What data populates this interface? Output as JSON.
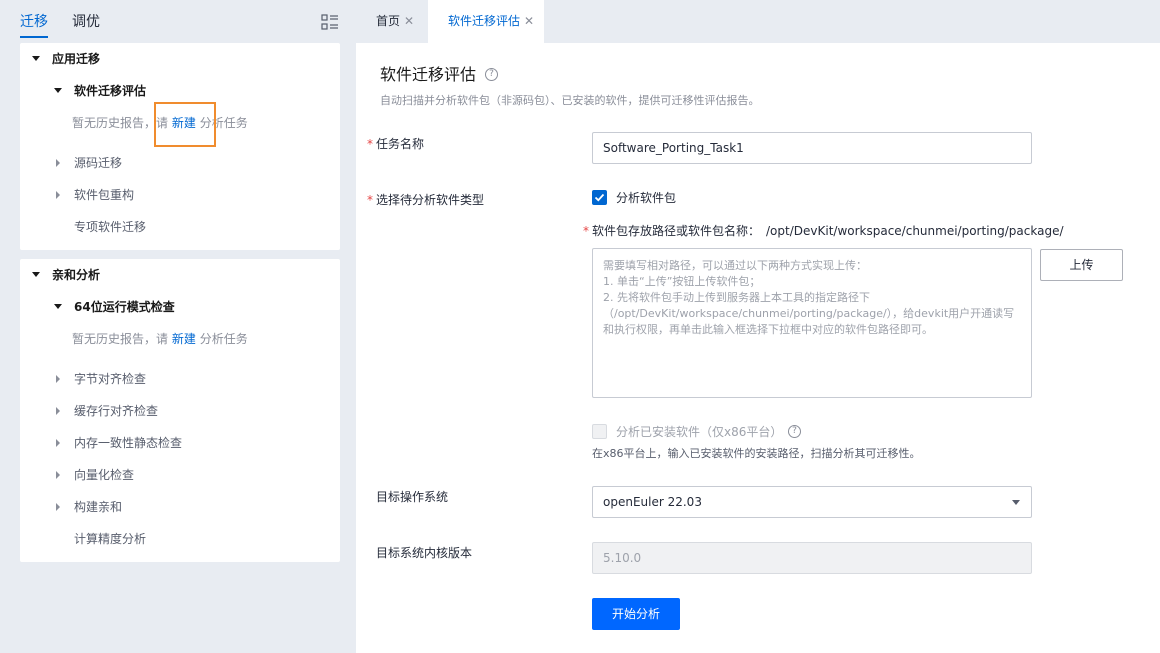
{
  "left_tabs": [
    {
      "label": "迁移",
      "active": true
    },
    {
      "label": "调优",
      "active": false
    }
  ],
  "tree": {
    "app_porting": {
      "label": "应用迁移",
      "software_eval": {
        "label": "软件迁移评估",
        "empty_prefix": "暂无历史报告，请",
        "empty_link": "新建",
        "empty_suffix": "分析任务"
      },
      "items": [
        "源码迁移",
        "软件包重构",
        "专项软件迁移"
      ]
    },
    "affinity": {
      "label": "亲和分析",
      "mode_check": {
        "label": "64位运行模式检查",
        "empty_prefix": "暂无历史报告，请",
        "empty_link": "新建",
        "empty_suffix": "分析任务"
      },
      "items": [
        "字节对齐检查",
        "缓存行对齐检查",
        "内存一致性静态检查",
        "向量化检查",
        "构建亲和",
        "计算精度分析"
      ]
    }
  },
  "top_tabs": [
    {
      "label": "首页",
      "active": false
    },
    {
      "label": "软件迁移评估",
      "active": true
    }
  ],
  "page": {
    "title": "软件迁移评估",
    "description": "自动扫描并分析软件包（非源码包）、已安装的软件，提供可迁移性评估报告。"
  },
  "form": {
    "task_name_label": "任务名称",
    "task_name_value": "Software_Porting_Task1",
    "type_label": "选择待分析软件类型",
    "analyze_package_label": "分析软件包",
    "analyze_package_checked": true,
    "path_label": "软件包存放路径或软件包名称：",
    "path_value": "/opt/DevKit/workspace/chunmei/porting/package/",
    "textarea_placeholder": [
      "需要填写相对路径，可以通过以下两种方式实现上传：",
      "1. 单击“上传”按钮上传软件包；",
      "2. 先将软件包手动上传到服务器上本工具的指定路径下",
      "（/opt/DevKit/workspace/chunmei/porting/package/），给devkit用户开通读写",
      "和执行权限，再单击此输入框选择下拉框中对应的软件包路径即可。"
    ],
    "upload_label": "上传",
    "analyze_installed_label": "分析已安装软件（仅x86平台）",
    "analyze_installed_checked": false,
    "installed_hint": "在x86平台上，输入已安装软件的安装路径，扫描分析其可迁移性。",
    "target_os_label": "目标操作系统",
    "target_os_value": "openEuler 22.03",
    "kernel_label": "目标系统内核版本",
    "kernel_value": "5.10.0",
    "start_label": "开始分析"
  },
  "colors": {
    "accent": "#0067d1",
    "primary_button": "#0067ff",
    "highlight_box": "#f08c2e",
    "required": "#e54545"
  }
}
